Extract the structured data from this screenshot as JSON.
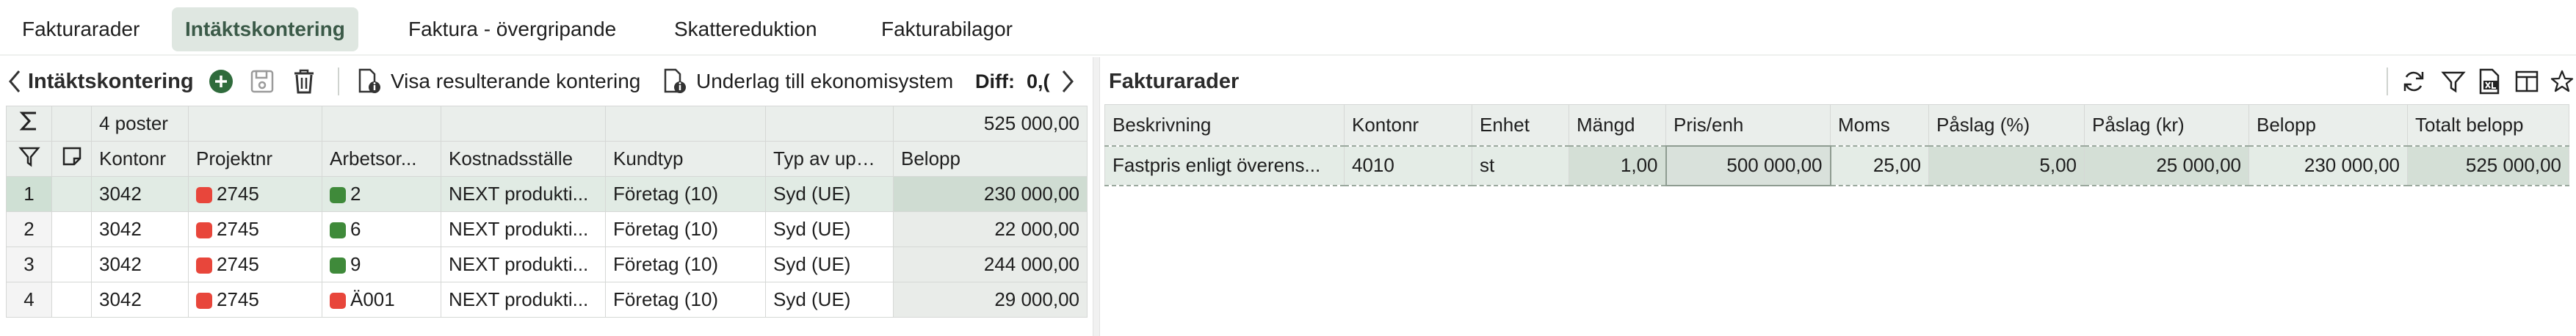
{
  "tabs": [
    {
      "label": "Fakturarader",
      "active": false
    },
    {
      "label": "Intäktskontering",
      "active": true
    },
    {
      "label": "Faktura - övergripande",
      "active": false
    },
    {
      "label": "Skattereduktion",
      "active": false
    },
    {
      "label": "Fakturabilagor",
      "active": false
    }
  ],
  "left": {
    "title": "Intäktskontering",
    "visa_label": "Visa resulterande kontering",
    "underlag_label": "Underlag till ekonomisystem",
    "diff_label": "Diff:",
    "diff_value": "0,(",
    "summary": {
      "count": "4 poster",
      "total": "525 000,00"
    },
    "columns": [
      "Kontonr",
      "Projektnr",
      "Arbetsor...",
      "Kostnadsställe",
      "Kundtyp",
      "Typ av uppdra",
      "Belopp"
    ],
    "rows": [
      {
        "num": "1",
        "kontonr": "3042",
        "projektnr": "2745",
        "arbetsorder": "2",
        "kostnadsstalle": "NEXT produkti...",
        "kundtyp": "Företag (10)",
        "typ": "Syd (UE)",
        "belopp": "230 000,00",
        "selected": true
      },
      {
        "num": "2",
        "kontonr": "3042",
        "projektnr": "2745",
        "arbetsorder": "6",
        "kostnadsstalle": "NEXT produkti...",
        "kundtyp": "Företag (10)",
        "typ": "Syd (UE)",
        "belopp": "22 000,00",
        "selected": false
      },
      {
        "num": "3",
        "kontonr": "3042",
        "projektnr": "2745",
        "arbetsorder": "9",
        "kostnadsstalle": "NEXT produkti...",
        "kundtyp": "Företag (10)",
        "typ": "Syd (UE)",
        "belopp": "244 000,00",
        "selected": false
      },
      {
        "num": "4",
        "kontonr": "3042",
        "projektnr": "2745",
        "arbetsorder": "Ä001",
        "kostnadsstalle": "NEXT produkti...",
        "kundtyp": "Företag (10)",
        "typ": "Syd (UE)",
        "belopp": "29 000,00",
        "selected": false
      }
    ]
  },
  "right": {
    "title": "Fakturarader",
    "columns": [
      "Beskrivning",
      "Kontonr",
      "Enhet",
      "Mängd",
      "Pris/enh",
      "Moms",
      "Påslag (%)",
      "Påslag (kr)",
      "Belopp",
      "Totalt belopp"
    ],
    "row": {
      "beskrivning": "Fastpris enligt överens...",
      "kontonr": "4010",
      "enhet": "st",
      "mangd": "1,00",
      "pris": "500 000,00",
      "moms": "25,00",
      "paslag_pct": "5,00",
      "paslag_kr": "25 000,00",
      "belopp": "230 000,00",
      "totalt": "525 000,00"
    }
  },
  "colors": {
    "accent": "#3b5a48",
    "active_tab_bg": "#dfe7e1",
    "status_red": "#e8463b",
    "status_green": "#3f8a3a",
    "add_button": "#2f6b3c"
  },
  "icons": [
    "chevron-left-icon",
    "add-icon",
    "save-icon",
    "trash-icon",
    "document-info-icon",
    "chevron-right-icon",
    "sum-icon",
    "filter-icon",
    "note-icon",
    "refresh-icon",
    "excel-export-icon",
    "columns-icon",
    "star-icon"
  ]
}
